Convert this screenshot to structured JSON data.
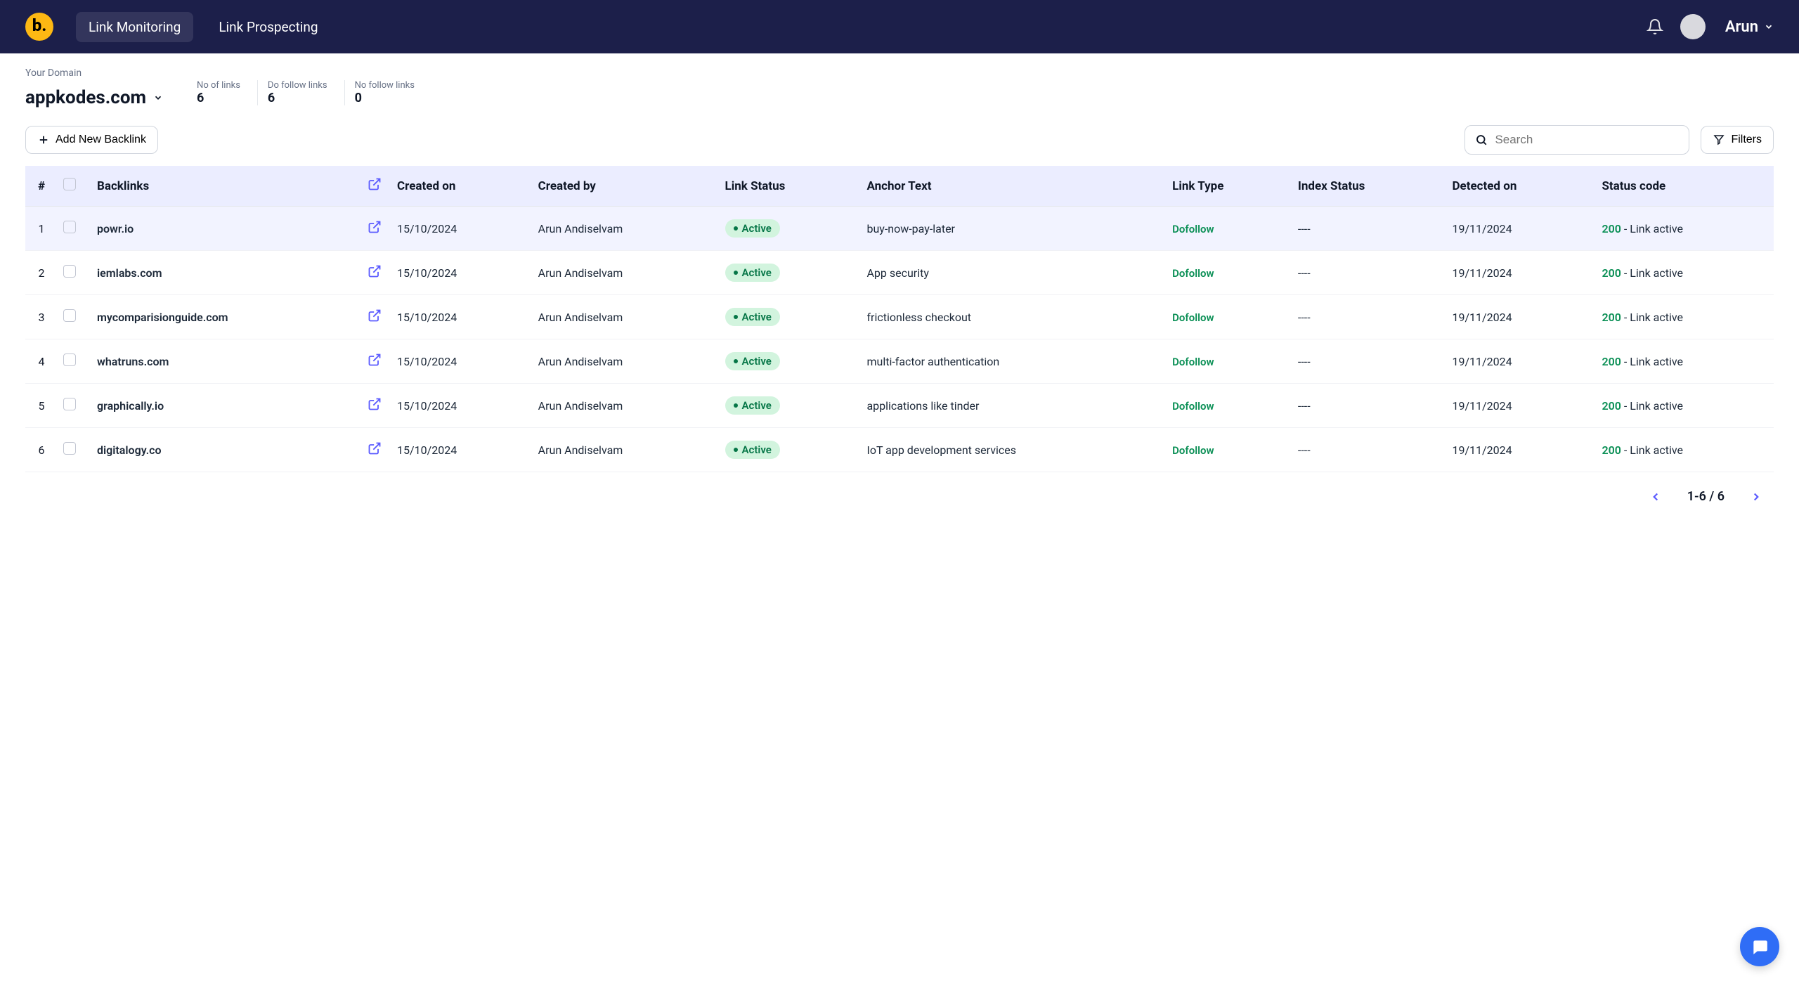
{
  "nav": {
    "tabs": [
      "Link Monitoring",
      "Link Prospecting"
    ],
    "activeTab": 0,
    "username": "Arun"
  },
  "domain": {
    "label": "Your Domain",
    "name": "appkodes.com"
  },
  "stats": [
    {
      "label": "No of links",
      "value": "6"
    },
    {
      "label": "Do follow links",
      "value": "6"
    },
    {
      "label": "No follow links",
      "value": "0"
    }
  ],
  "toolbar": {
    "addBacklinkLabel": "Add New Backlink",
    "searchPlaceholder": "Search",
    "filtersLabel": "Filters"
  },
  "table": {
    "headers": {
      "num": "#",
      "backlinks": "Backlinks",
      "createdOn": "Created on",
      "createdBy": "Created by",
      "linkStatus": "Link Status",
      "anchorText": "Anchor Text",
      "linkType": "Link Type",
      "indexStatus": "Index Status",
      "detectedOn": "Detected on",
      "statusCode": "Status code"
    },
    "rows": [
      {
        "backlink": "powr.io",
        "createdOn": "15/10/2024",
        "createdBy": "Arun Andiselvam",
        "linkStatus": "Active",
        "anchorText": "buy-now-pay-later",
        "linkType": "Dofollow",
        "indexStatus": "----",
        "detectedOn": "19/11/2024",
        "statusCode": "200",
        "statusText": " - Link active"
      },
      {
        "backlink": "iemlabs.com",
        "createdOn": "15/10/2024",
        "createdBy": "Arun Andiselvam",
        "linkStatus": "Active",
        "anchorText": "App security",
        "linkType": "Dofollow",
        "indexStatus": "----",
        "detectedOn": "19/11/2024",
        "statusCode": "200",
        "statusText": " - Link active"
      },
      {
        "backlink": "mycomparisionguide.com",
        "createdOn": "15/10/2024",
        "createdBy": "Arun Andiselvam",
        "linkStatus": "Active",
        "anchorText": "frictionless checkout",
        "linkType": "Dofollow",
        "indexStatus": "----",
        "detectedOn": "19/11/2024",
        "statusCode": "200",
        "statusText": " - Link active"
      },
      {
        "backlink": "whatruns.com",
        "createdOn": "15/10/2024",
        "createdBy": "Arun Andiselvam",
        "linkStatus": "Active",
        "anchorText": "multi-factor authentication",
        "linkType": "Dofollow",
        "indexStatus": "----",
        "detectedOn": "19/11/2024",
        "statusCode": "200",
        "statusText": " - Link active"
      },
      {
        "backlink": "graphically.io",
        "createdOn": "15/10/2024",
        "createdBy": "Arun Andiselvam",
        "linkStatus": "Active",
        "anchorText": "applications like tinder",
        "linkType": "Dofollow",
        "indexStatus": "----",
        "detectedOn": "19/11/2024",
        "statusCode": "200",
        "statusText": " - Link active"
      },
      {
        "backlink": "digitalogy.co",
        "createdOn": "15/10/2024",
        "createdBy": "Arun Andiselvam",
        "linkStatus": "Active",
        "anchorText": "IoT app development services",
        "linkType": "Dofollow",
        "indexStatus": "----",
        "detectedOn": "19/11/2024",
        "statusCode": "200",
        "statusText": " - Link active"
      }
    ]
  },
  "pagination": {
    "range": "1-6 / 6"
  }
}
